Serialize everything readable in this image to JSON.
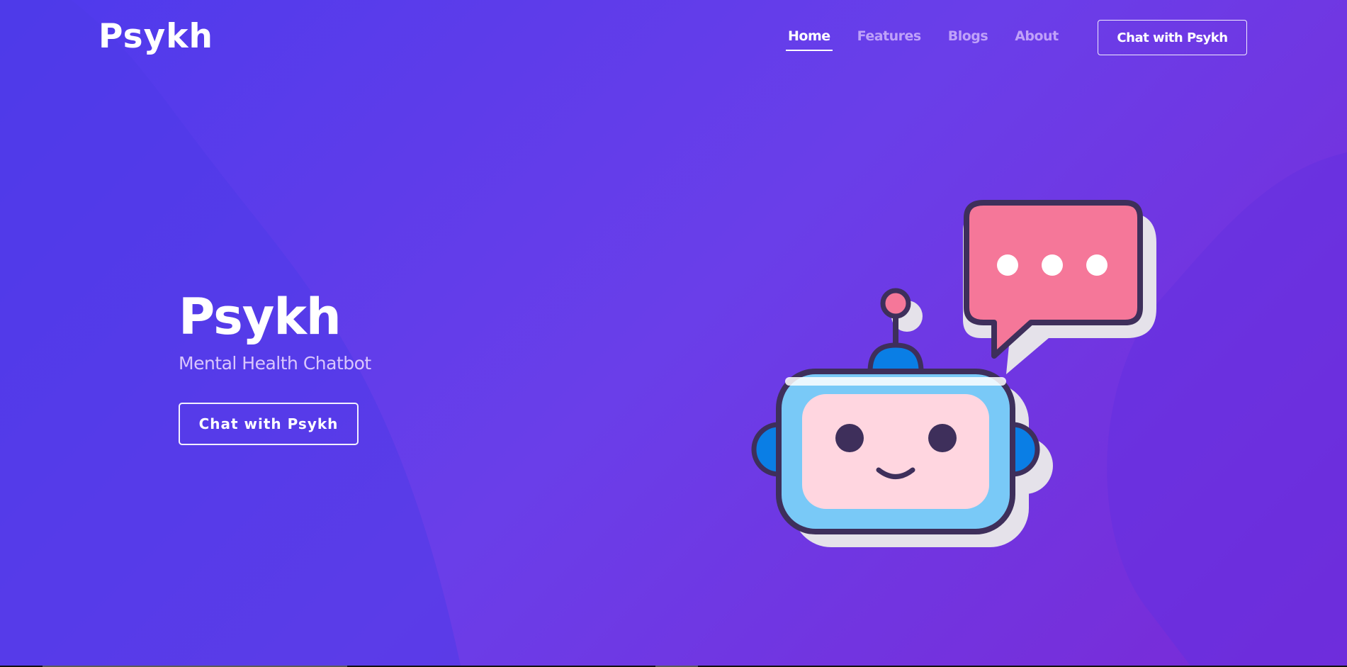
{
  "brand": {
    "logo_text": "Psykh"
  },
  "nav": {
    "items": [
      {
        "label": "Home",
        "active": true
      },
      {
        "label": "Features",
        "active": false
      },
      {
        "label": "Blogs",
        "active": false
      },
      {
        "label": "About",
        "active": false
      }
    ],
    "cta_label": "Chat with Psykh"
  },
  "hero": {
    "title": "Psykh",
    "subtitle": "Mental Health Chatbot",
    "cta_label": "Chat with Psykh"
  },
  "illustration": {
    "icon": "robot-chat-icon",
    "bubble_icon": "speech-bubble-icon",
    "colors": {
      "bubble": "#f57799",
      "outline": "#3e2f5b",
      "face": "#ffd6e0",
      "screen": "#79c9f7",
      "ears": "#0a7ee5"
    }
  },
  "colors": {
    "gradient_start": "#4e3aec",
    "gradient_end": "#7a2ad6",
    "text": "#ffffff"
  }
}
